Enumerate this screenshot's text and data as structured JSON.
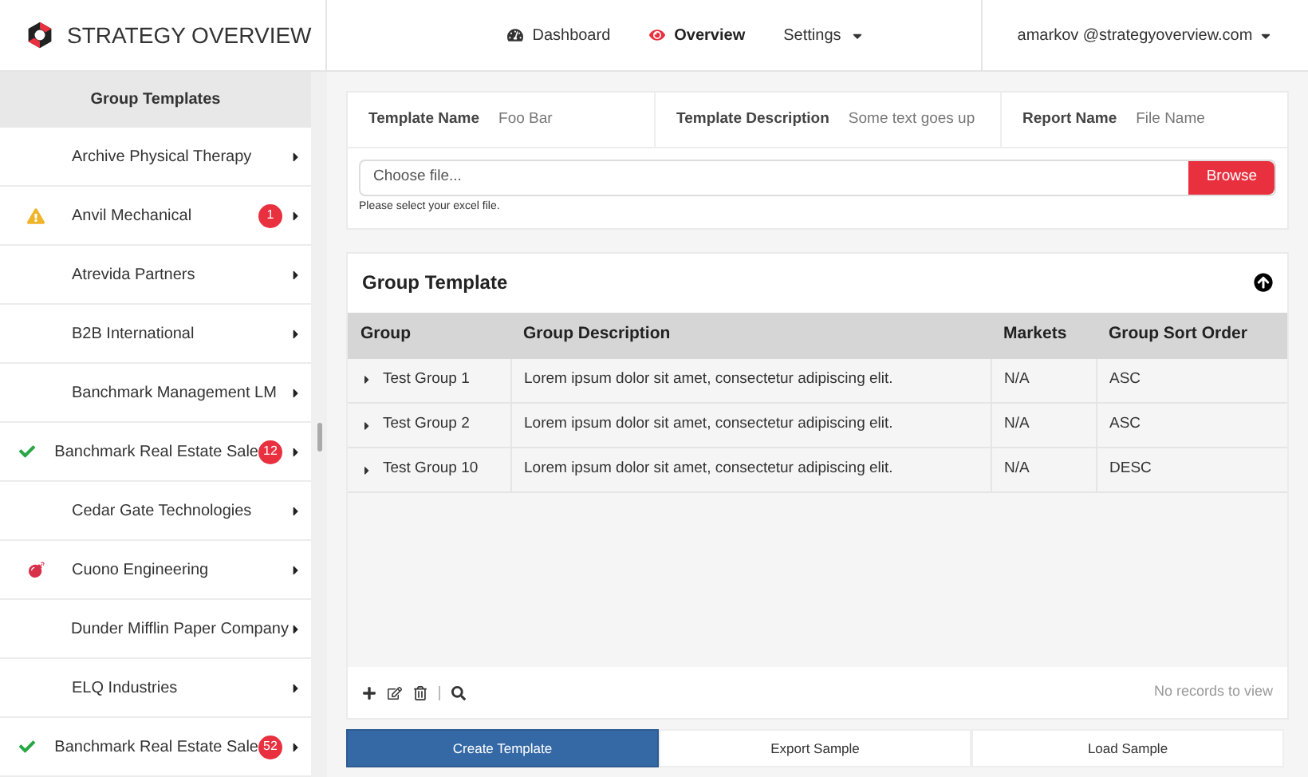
{
  "brand": {
    "name": "STRATEGY OVERVIEW"
  },
  "nav": [
    {
      "label": "Dashboard",
      "kind": "dashboard",
      "selected": false,
      "dropdown": false
    },
    {
      "label": "Overview",
      "kind": "eye",
      "selected": true,
      "dropdown": false
    },
    {
      "label": "Settings",
      "kind": "plain",
      "selected": false,
      "dropdown": true
    }
  ],
  "user": {
    "label": "amarkov @strategyoverview.com"
  },
  "sidebar": {
    "title": "Group Templates",
    "items": [
      {
        "label": "Archive Physical Therapy",
        "kind": "plain"
      },
      {
        "label": "Anvil Mechanical",
        "kind": "warning",
        "badge": "1"
      },
      {
        "label": "Atrevida Partners",
        "kind": "plain"
      },
      {
        "label": "B2B International",
        "kind": "plain"
      },
      {
        "label": "Banchmark Management LM",
        "kind": "plain"
      },
      {
        "label": "Banchmark Real Estate Sale",
        "kind": "done",
        "badge": "12"
      },
      {
        "label": "Cedar Gate Technologies",
        "kind": "plain"
      },
      {
        "label": "Cuono Engineering",
        "kind": "bomb"
      },
      {
        "label": "Dunder Mifflin Paper Company",
        "kind": "plain"
      },
      {
        "label": "ELQ Industries",
        "kind": "plain"
      },
      {
        "label": "Banchmark Real Estate Sale",
        "kind": "done",
        "badge": "52"
      }
    ]
  },
  "form": {
    "fields": [
      {
        "label": "Template Name",
        "value": "Foo Bar"
      },
      {
        "label": "Template Description",
        "value": "Some text goes up"
      },
      {
        "label": "Report Name",
        "value": "File Name"
      }
    ],
    "file": {
      "placeholder": "Choose file...",
      "button": "Browse",
      "hint": "Please select your excel file."
    }
  },
  "group_template": {
    "title": "Group Template",
    "columns": [
      "Group",
      "Group Description",
      "Markets",
      "Group Sort Order"
    ],
    "rows": [
      {
        "group": "Test Group 1",
        "description": "Lorem ipsum dolor sit amet, consectetur adipiscing elit.",
        "markets": "N/A",
        "sort": "ASC"
      },
      {
        "group": "Test Group 2",
        "description": "Lorem ipsum dolor sit amet, consectetur adipiscing elit.",
        "markets": "N/A",
        "sort": "ASC"
      },
      {
        "group": "Test Group 10",
        "description": "Lorem ipsum dolor sit amet, consectetur adipiscing elit.",
        "markets": "N/A",
        "sort": "DESC"
      }
    ],
    "empty": "No records to view"
  },
  "actions": [
    {
      "label": "Create Template",
      "primary": true
    },
    {
      "label": "Export Sample",
      "primary": false
    },
    {
      "label": "Load Sample",
      "primary": false
    }
  ]
}
